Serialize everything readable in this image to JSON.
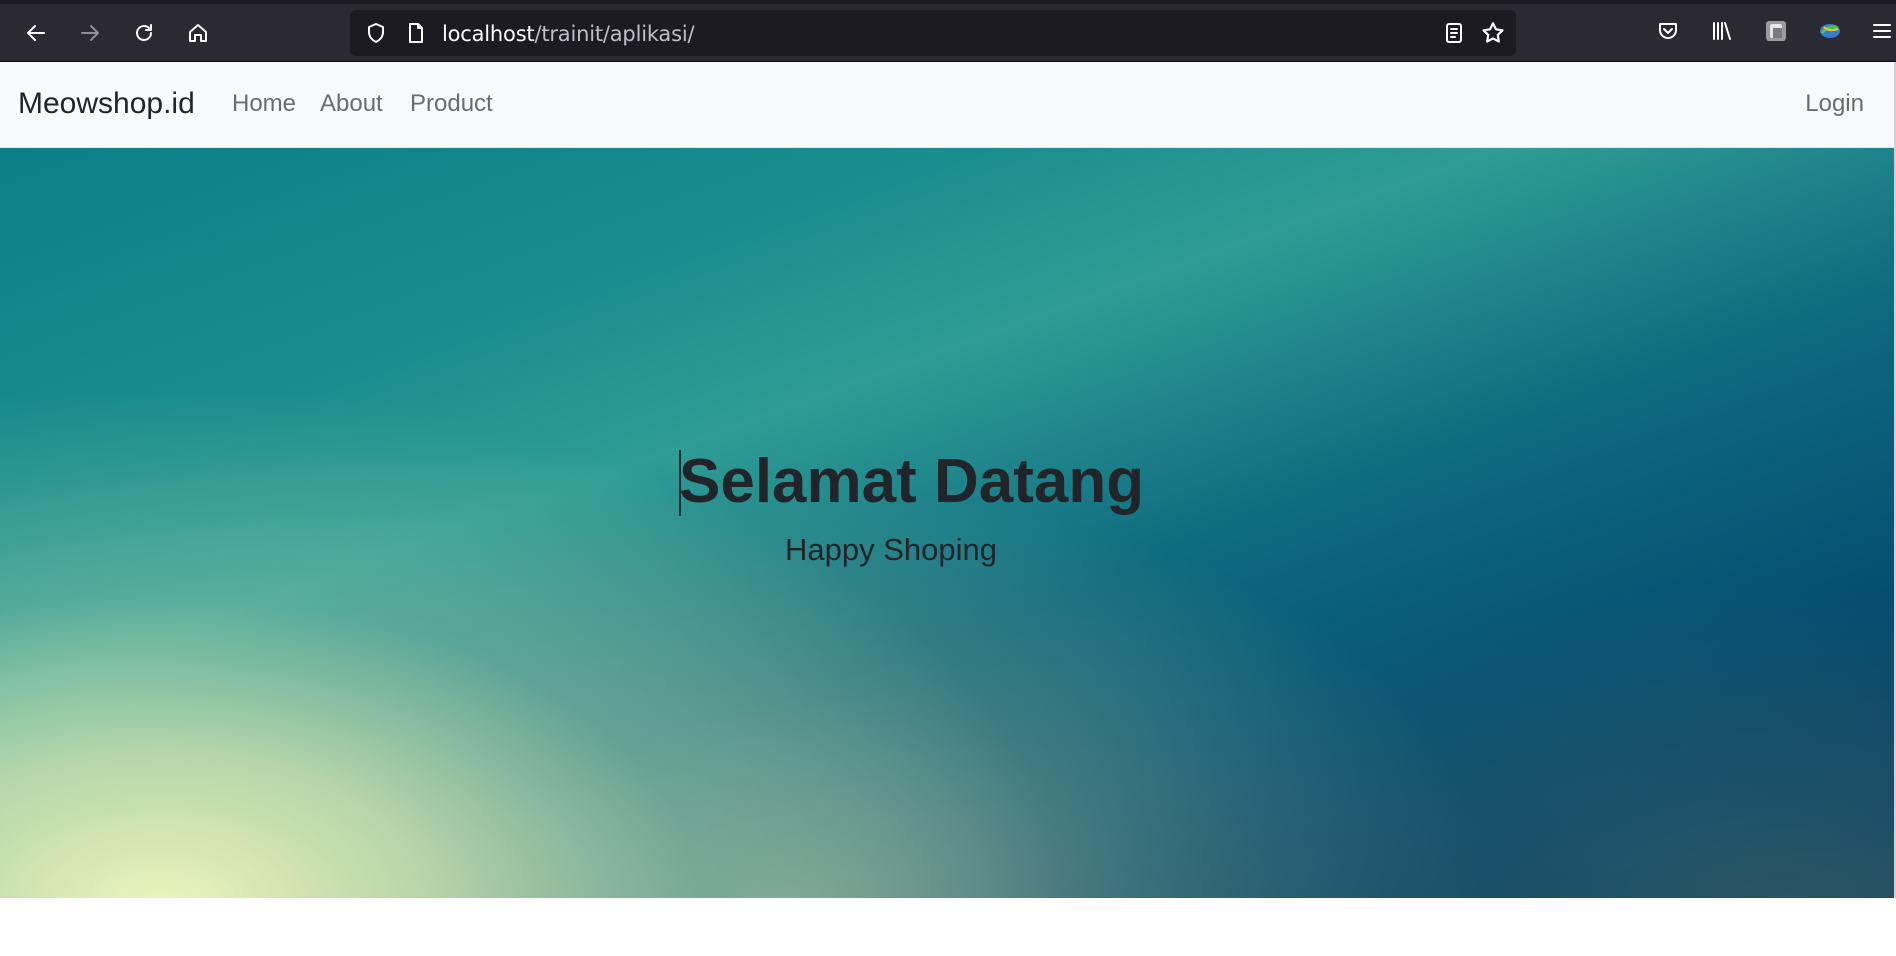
{
  "browser": {
    "url_host": "localhost",
    "url_path": "/trainit/aplikasi/",
    "icons": [
      "back-icon",
      "forward-icon",
      "reload-icon",
      "home-icon",
      "shield-icon",
      "page-icon",
      "reader-view-icon",
      "bookmark-star-icon",
      "pocket-icon",
      "library-icon",
      "extension-icon",
      "idm-icon",
      "menu-icon"
    ]
  },
  "navbar": {
    "brand": "Meowshop.id",
    "links": [
      {
        "label": "Home"
      },
      {
        "label": "About"
      },
      {
        "label": "Product"
      }
    ],
    "login": "Login"
  },
  "hero": {
    "title": "Selamat Datang",
    "subtitle": "Happy Shoping"
  }
}
